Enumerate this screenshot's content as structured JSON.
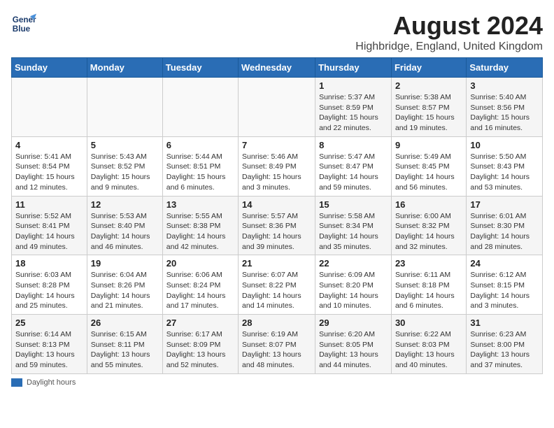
{
  "header": {
    "logo_line1": "General",
    "logo_line2": "Blue",
    "main_title": "August 2024",
    "subtitle": "Highbridge, England, United Kingdom"
  },
  "footer": {
    "note": "Daylight hours"
  },
  "weekdays": [
    "Sunday",
    "Monday",
    "Tuesday",
    "Wednesday",
    "Thursday",
    "Friday",
    "Saturday"
  ],
  "weeks": [
    [
      {
        "day": "",
        "info": ""
      },
      {
        "day": "",
        "info": ""
      },
      {
        "day": "",
        "info": ""
      },
      {
        "day": "",
        "info": ""
      },
      {
        "day": "1",
        "info": "Sunrise: 5:37 AM\nSunset: 8:59 PM\nDaylight: 15 hours\nand 22 minutes."
      },
      {
        "day": "2",
        "info": "Sunrise: 5:38 AM\nSunset: 8:57 PM\nDaylight: 15 hours\nand 19 minutes."
      },
      {
        "day": "3",
        "info": "Sunrise: 5:40 AM\nSunset: 8:56 PM\nDaylight: 15 hours\nand 16 minutes."
      }
    ],
    [
      {
        "day": "4",
        "info": "Sunrise: 5:41 AM\nSunset: 8:54 PM\nDaylight: 15 hours\nand 12 minutes."
      },
      {
        "day": "5",
        "info": "Sunrise: 5:43 AM\nSunset: 8:52 PM\nDaylight: 15 hours\nand 9 minutes."
      },
      {
        "day": "6",
        "info": "Sunrise: 5:44 AM\nSunset: 8:51 PM\nDaylight: 15 hours\nand 6 minutes."
      },
      {
        "day": "7",
        "info": "Sunrise: 5:46 AM\nSunset: 8:49 PM\nDaylight: 15 hours\nand 3 minutes."
      },
      {
        "day": "8",
        "info": "Sunrise: 5:47 AM\nSunset: 8:47 PM\nDaylight: 14 hours\nand 59 minutes."
      },
      {
        "day": "9",
        "info": "Sunrise: 5:49 AM\nSunset: 8:45 PM\nDaylight: 14 hours\nand 56 minutes."
      },
      {
        "day": "10",
        "info": "Sunrise: 5:50 AM\nSunset: 8:43 PM\nDaylight: 14 hours\nand 53 minutes."
      }
    ],
    [
      {
        "day": "11",
        "info": "Sunrise: 5:52 AM\nSunset: 8:41 PM\nDaylight: 14 hours\nand 49 minutes."
      },
      {
        "day": "12",
        "info": "Sunrise: 5:53 AM\nSunset: 8:40 PM\nDaylight: 14 hours\nand 46 minutes."
      },
      {
        "day": "13",
        "info": "Sunrise: 5:55 AM\nSunset: 8:38 PM\nDaylight: 14 hours\nand 42 minutes."
      },
      {
        "day": "14",
        "info": "Sunrise: 5:57 AM\nSunset: 8:36 PM\nDaylight: 14 hours\nand 39 minutes."
      },
      {
        "day": "15",
        "info": "Sunrise: 5:58 AM\nSunset: 8:34 PM\nDaylight: 14 hours\nand 35 minutes."
      },
      {
        "day": "16",
        "info": "Sunrise: 6:00 AM\nSunset: 8:32 PM\nDaylight: 14 hours\nand 32 minutes."
      },
      {
        "day": "17",
        "info": "Sunrise: 6:01 AM\nSunset: 8:30 PM\nDaylight: 14 hours\nand 28 minutes."
      }
    ],
    [
      {
        "day": "18",
        "info": "Sunrise: 6:03 AM\nSunset: 8:28 PM\nDaylight: 14 hours\nand 25 minutes."
      },
      {
        "day": "19",
        "info": "Sunrise: 6:04 AM\nSunset: 8:26 PM\nDaylight: 14 hours\nand 21 minutes."
      },
      {
        "day": "20",
        "info": "Sunrise: 6:06 AM\nSunset: 8:24 PM\nDaylight: 14 hours\nand 17 minutes."
      },
      {
        "day": "21",
        "info": "Sunrise: 6:07 AM\nSunset: 8:22 PM\nDaylight: 14 hours\nand 14 minutes."
      },
      {
        "day": "22",
        "info": "Sunrise: 6:09 AM\nSunset: 8:20 PM\nDaylight: 14 hours\nand 10 minutes."
      },
      {
        "day": "23",
        "info": "Sunrise: 6:11 AM\nSunset: 8:18 PM\nDaylight: 14 hours\nand 6 minutes."
      },
      {
        "day": "24",
        "info": "Sunrise: 6:12 AM\nSunset: 8:15 PM\nDaylight: 14 hours\nand 3 minutes."
      }
    ],
    [
      {
        "day": "25",
        "info": "Sunrise: 6:14 AM\nSunset: 8:13 PM\nDaylight: 13 hours\nand 59 minutes."
      },
      {
        "day": "26",
        "info": "Sunrise: 6:15 AM\nSunset: 8:11 PM\nDaylight: 13 hours\nand 55 minutes."
      },
      {
        "day": "27",
        "info": "Sunrise: 6:17 AM\nSunset: 8:09 PM\nDaylight: 13 hours\nand 52 minutes."
      },
      {
        "day": "28",
        "info": "Sunrise: 6:19 AM\nSunset: 8:07 PM\nDaylight: 13 hours\nand 48 minutes."
      },
      {
        "day": "29",
        "info": "Sunrise: 6:20 AM\nSunset: 8:05 PM\nDaylight: 13 hours\nand 44 minutes."
      },
      {
        "day": "30",
        "info": "Sunrise: 6:22 AM\nSunset: 8:03 PM\nDaylight: 13 hours\nand 40 minutes."
      },
      {
        "day": "31",
        "info": "Sunrise: 6:23 AM\nSunset: 8:00 PM\nDaylight: 13 hours\nand 37 minutes."
      }
    ]
  ]
}
